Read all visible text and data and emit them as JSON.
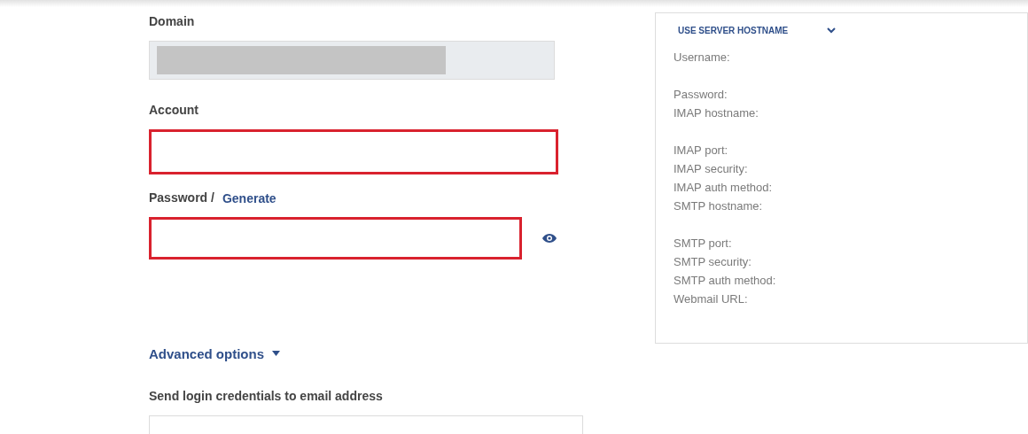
{
  "form": {
    "domain": {
      "label": "Domain",
      "disabled": true,
      "redacted": true
    },
    "account": {
      "label": "Account",
      "highlighted": true
    },
    "password": {
      "label": "Password /",
      "generate_link": "Generate",
      "highlighted": true
    },
    "advanced": {
      "label": "Advanced options",
      "expanded": false
    },
    "send_credentials": {
      "label": "Send login credentials to email address",
      "highlighted": false
    }
  },
  "server_panel": {
    "title": "USE SERVER HOSTNAME",
    "expanded": false,
    "groups": [
      [
        "Username:"
      ],
      [
        "Password:",
        "IMAP hostname:"
      ],
      [
        "IMAP port:",
        "IMAP security:",
        "IMAP auth method:",
        "SMTP hostname:"
      ],
      [
        "SMTP port:",
        "SMTP security:",
        "SMTP auth method:",
        "Webmail URL:"
      ]
    ]
  }
}
